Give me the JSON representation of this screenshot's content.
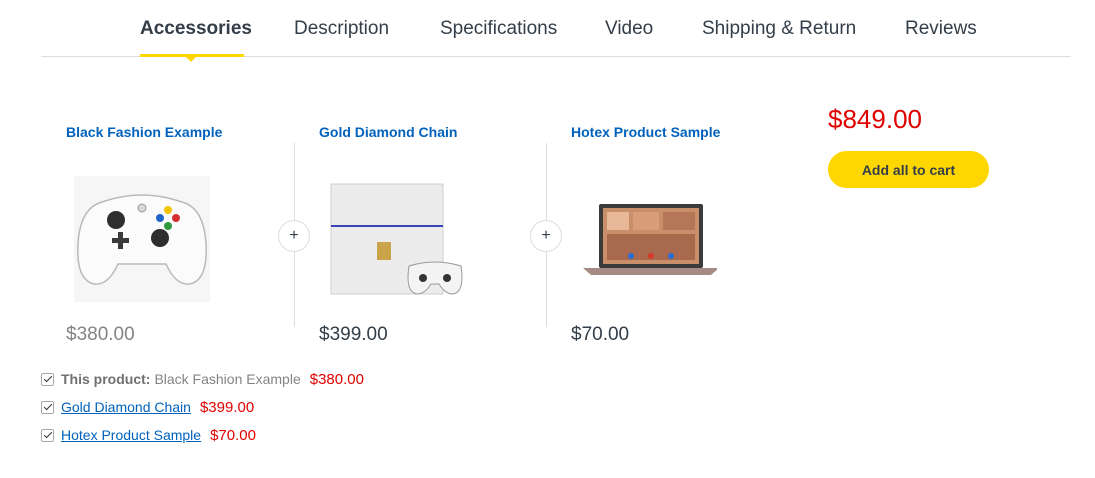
{
  "tabs": [
    {
      "label": "Accessories"
    },
    {
      "label": "Description"
    },
    {
      "label": "Specifications"
    },
    {
      "label": "Video"
    },
    {
      "label": "Shipping & Return"
    },
    {
      "label": "Reviews"
    }
  ],
  "active_tab": "Accessories",
  "products": [
    {
      "title": "Black Fashion Example",
      "price": "$380.00",
      "image": "xbox-controller"
    },
    {
      "title": "Gold Diamond Chain",
      "price": "$399.00",
      "image": "game-console"
    },
    {
      "title": "Hotex Product Sample",
      "price": "$70.00",
      "image": "laptop"
    }
  ],
  "plus_symbol": "+",
  "total_price": "$849.00",
  "add_all_label": "Add all to cart",
  "checklist": [
    {
      "prefix": "This product:",
      "name": "Black Fashion Example",
      "price": "$380.00",
      "checked": true
    },
    {
      "name": "Gold Diamond Chain",
      "price": "$399.00",
      "checked": true
    },
    {
      "name": "Hotex Product Sample",
      "price": "$70.00",
      "checked": true
    }
  ],
  "colors": {
    "accent": "#fed700",
    "price_red": "#df0000",
    "link_blue": "#0062bd"
  }
}
